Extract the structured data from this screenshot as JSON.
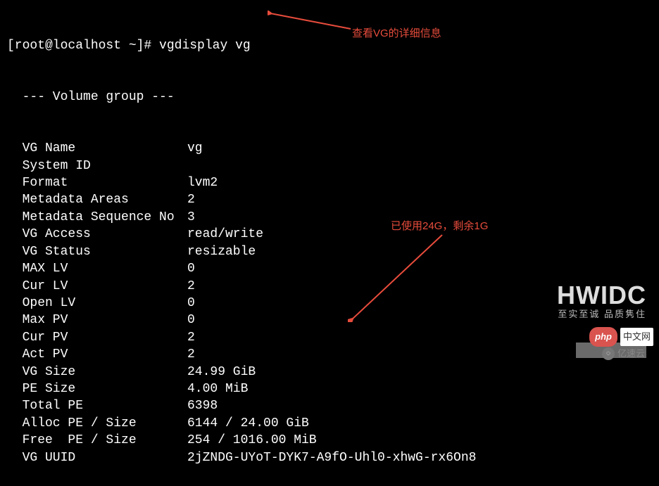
{
  "prompt": {
    "user_host": "[root@localhost ~]#",
    "command": "vgdisplay vg"
  },
  "header": "  --- Volume group ---",
  "rows": [
    {
      "label": "  VG Name",
      "value": "vg"
    },
    {
      "label": "  System ID",
      "value": ""
    },
    {
      "label": "  Format",
      "value": "lvm2"
    },
    {
      "label": "  Metadata Areas",
      "value": "2"
    },
    {
      "label": "  Metadata Sequence No",
      "value": "3"
    },
    {
      "label": "  VG Access",
      "value": "read/write"
    },
    {
      "label": "  VG Status",
      "value": "resizable"
    },
    {
      "label": "  MAX LV",
      "value": "0"
    },
    {
      "label": "  Cur LV",
      "value": "2"
    },
    {
      "label": "  Open LV",
      "value": "0"
    },
    {
      "label": "  Max PV",
      "value": "0"
    },
    {
      "label": "  Cur PV",
      "value": "2"
    },
    {
      "label": "  Act PV",
      "value": "2"
    },
    {
      "label": "  VG Size",
      "value": "24.99 GiB"
    },
    {
      "label": "  PE Size",
      "value": "4.00 MiB"
    },
    {
      "label": "  Total PE",
      "value": "6398"
    },
    {
      "label": "  Alloc PE / Size",
      "value": "6144 / 24.00 GiB"
    },
    {
      "label": "  Free  PE / Size",
      "value": "254 / 1016.00 MiB"
    },
    {
      "label": "  VG UUID",
      "value": "2jZNDG-UYoT-DYK7-A9fO-Uhl0-xhwG-rx6On8"
    }
  ],
  "annotations": {
    "top": "查看VG的详细信息",
    "bottom": "已使用24G，剩余1G"
  },
  "watermarks": {
    "hwidc": "HWIDC",
    "hwidc_sub": "至实至诚 品质隽住",
    "php_badge": "php",
    "php_text": "中文网",
    "yisu": "亿速云"
  }
}
